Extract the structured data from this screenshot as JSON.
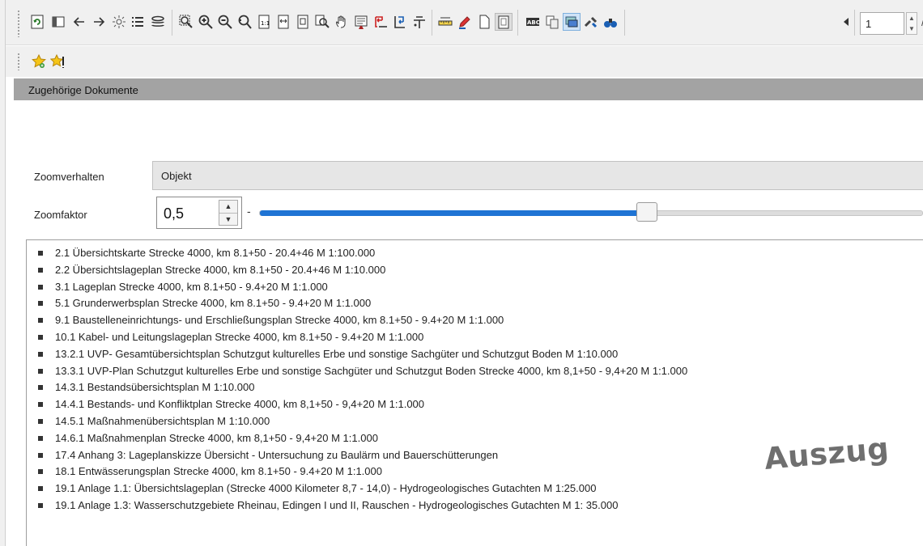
{
  "toolbar": {
    "icons": [
      "refresh-icon",
      "panel-icon",
      "arrow-left-icon",
      "arrow-right-icon",
      "brightness-icon",
      "list-icon",
      "layers-icon",
      "zoom-selection-icon",
      "zoom-in-icon",
      "zoom-out-icon",
      "zoom-reset-icon",
      "fit-page-icon",
      "fit-width-icon",
      "fit-object-icon",
      "zoom-search-icon",
      "pan-hand-icon",
      "select-text-icon",
      "export-icon",
      "import-icon",
      "crosshair-icon",
      "measure-icon",
      "pen-icon",
      "new-document-icon",
      "clipboard-icon",
      "ocr-icon",
      "copy-icon",
      "highlight-icon",
      "tools-icon",
      "binoculars-icon",
      "previous-page-icon"
    ],
    "page_number": "1",
    "page_separator": "/"
  },
  "toolbar2": {
    "icons": [
      "favorite-add-icon",
      "favorite-manage-icon"
    ]
  },
  "section": {
    "title": "Zugehörige Dokumente"
  },
  "zoom": {
    "mode_label": "Zoomverhalten",
    "mode_value": "Objekt",
    "factor_label": "Zoomfaktor",
    "factor_value": "0,5",
    "slider_separator": "-",
    "slider_level": 0.58
  },
  "documents": [
    "2.1 Übersichtskarte Strecke 4000, km 8.1+50 - 20.4+46   M 1:100.000",
    "2.2 Übersichtslageplan Strecke 4000, km 8.1+50 - 20.4+46   M 1:10.000",
    "3.1 Lageplan Strecke 4000, km 8.1+50 - 9.4+20   M 1:1.000",
    "5.1 Grunderwerbsplan Strecke 4000, km 8.1+50 - 9.4+20   M 1:1.000",
    "9.1 Baustelleneinrichtungs- und Erschließungsplan Strecke 4000, km 8.1+50 - 9.4+20   M 1:1.000",
    "10.1 Kabel- und Leitungslageplan Strecke 4000, km 8.1+50 - 9.4+20   M 1:1.000",
    "13.2.1 UVP- Gesamtübersichtsplan Schutzgut kulturelles Erbe und sonstige Sachgüter und Schutzgut Boden   M 1:10.000",
    "13.3.1 UVP-Plan Schutzgut kulturelles Erbe und sonstige Sachgüter und Schutzgut Boden Strecke 4000, km 8,1+50 - 9,4+20   M 1:1.000",
    "14.3.1 Bestandsübersichtsplan   M 1:10.000",
    "14.4.1 Bestands- und Konfliktplan Strecke 4000, km 8,1+50 - 9,4+20   M 1:1.000",
    "14.5.1 Maßnahmenübersichtsplan   M 1:10.000",
    "14.6.1 Maßnahmenplan Strecke 4000, km 8,1+50 - 9,4+20   M 1:1.000",
    "17.4 Anhang 3: Lageplanskizze Übersicht - Untersuchung zu Baulärm und Bauerschütterungen",
    "18.1 Entwässerungsplan Strecke 4000, km 8.1+50 - 9.4+20   M 1:1.000",
    "19.1 Anlage 1.1: Übersichtslageplan (Strecke 4000 Kilometer 8,7 - 14,0) - Hydrogeologisches Gutachten   M 1:25.000",
    "19.1 Anlage 1.3: Wasserschutzgebiete Rheinau, Edingen I und II, Rauschen - Hydrogeologisches Gutachten   M 1: 35.000"
  ],
  "overlay": {
    "stamp_text": "Auszug"
  }
}
